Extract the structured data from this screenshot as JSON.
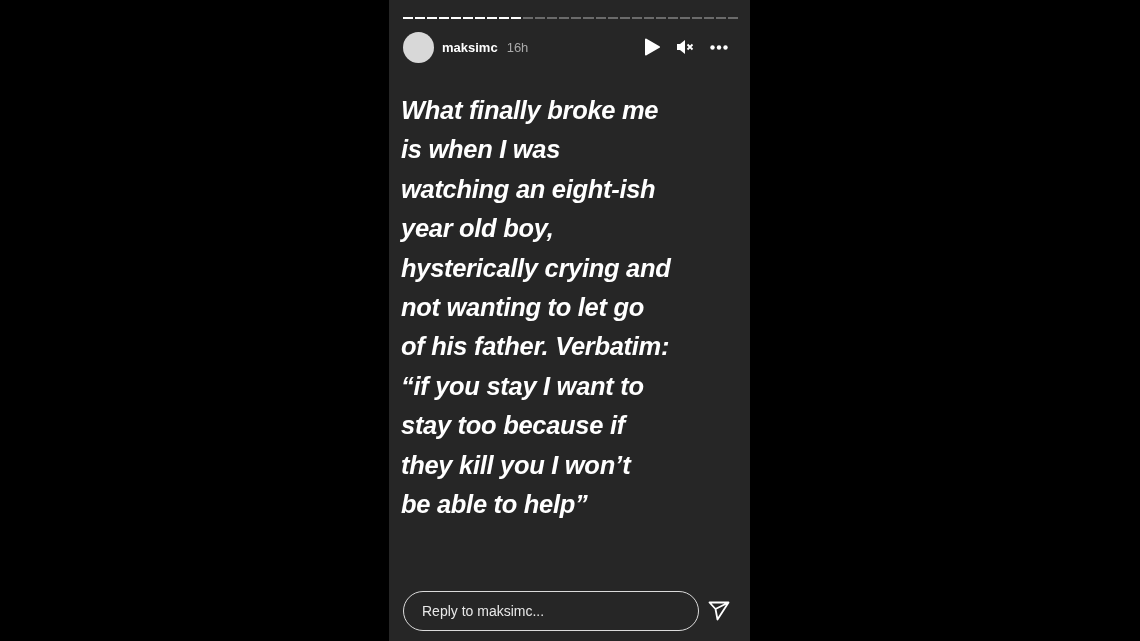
{
  "progress": [
    {
      "seen": true
    },
    {
      "seen": true
    },
    {
      "seen": true
    },
    {
      "seen": true
    },
    {
      "seen": true
    },
    {
      "seen": true
    },
    {
      "seen": true
    },
    {
      "seen": true
    },
    {
      "seen": true
    },
    {
      "seen": true
    },
    {
      "seen": false
    },
    {
      "seen": false
    },
    {
      "seen": false
    },
    {
      "seen": false
    },
    {
      "seen": false
    },
    {
      "seen": false
    },
    {
      "seen": false
    },
    {
      "seen": false
    },
    {
      "seen": false
    },
    {
      "seen": false
    },
    {
      "seen": false
    },
    {
      "seen": false
    },
    {
      "seen": false
    },
    {
      "seen": false
    },
    {
      "seen": false
    },
    {
      "seen": false
    },
    {
      "seen": false
    },
    {
      "seen": false
    }
  ],
  "header": {
    "username": "maksimc",
    "time": "16h",
    "muted": true
  },
  "story_text": "What finally broke me\nis when I was\nwatching an eight-ish\nyear old boy,\nhysterically crying and\nnot wanting to let go\nof his father. Verbatim:\n“if you stay I want to\nstay too because if\nthey kill you I won’t\nbe able to help”",
  "reply": {
    "placeholder": "Reply to maksimc..."
  }
}
